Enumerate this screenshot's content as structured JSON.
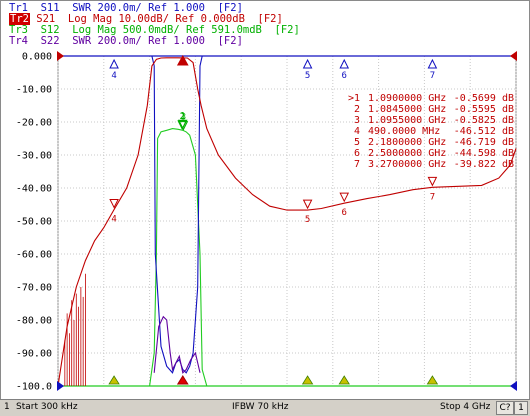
{
  "traces_header": [
    {
      "id": "Tr1",
      "text": "Tr1  S11  SWR 200.0m/ Ref 1.000  [F2]",
      "color": "#1010c0",
      "active": false
    },
    {
      "id": "Tr2",
      "tag": "Tr2",
      "text": " S21  Log Mag 10.00dB/ Ref 0.000dB  [F2]",
      "color": "#c00000",
      "active": true
    },
    {
      "id": "Tr3",
      "text": "Tr3  S12  Log Mag 500.0mdB/ Ref 591.0mdB  [F2]",
      "color": "#00b000",
      "active": false
    },
    {
      "id": "Tr4",
      "text": "Tr4  S22  SWR 200.0m/ Ref 1.000  [F2]",
      "color": "#6000a0",
      "active": false
    }
  ],
  "marker_table": [
    {
      "label": ">1",
      "freq": "1.0900000 GHz",
      "value": "-0.5699 dB"
    },
    {
      "label": "2",
      "freq": "1.0845000 GHz",
      "value": "-0.5595 dB"
    },
    {
      "label": "3",
      "freq": "1.0955000 GHz",
      "value": "-0.5825 dB"
    },
    {
      "label": "4",
      "freq": "490.0000 MHz",
      "value": "-46.512 dB"
    },
    {
      "label": "5",
      "freq": "2.1800000 GHz",
      "value": "-46.719 dB"
    },
    {
      "label": "6",
      "freq": "2.5000000 GHz",
      "value": "-44.598 dB"
    },
    {
      "label": "7",
      "freq": "3.2700000 GHz",
      "value": "-39.822 dB"
    }
  ],
  "statusbar": {
    "channel": "1",
    "start": "Start 300 kHz",
    "ifbw": "IFBW 70 kHz",
    "stop": "Stop 4 GHz",
    "ch_tag": "C?",
    "box": "1"
  },
  "colors": {
    "s11": "#1010c0",
    "s21": "#c00000",
    "s12": "#22cc22",
    "s22": "#6000a0",
    "grid": "#c8c8c8"
  },
  "chart_data": {
    "type": "line",
    "xlabel": "",
    "ylabel": "",
    "xlim": [
      0.0003,
      4.0
    ],
    "ylim": [
      -100,
      0
    ],
    "y_ticks": [
      0,
      -10,
      -20,
      -30,
      -40,
      -50,
      -60,
      -70,
      -80,
      -90,
      -100
    ],
    "y_tick_labels": [
      "0.000",
      "-10.00",
      "-20.00",
      "-30.00",
      "-40.00",
      "-50.00",
      "-60.00",
      "-70.00",
      "-80.00",
      "-90.00",
      "-100.0"
    ],
    "grid": true,
    "series": [
      {
        "name": "S21",
        "color": "#c00000",
        "x": [
          0.0003,
          0.08,
          0.16,
          0.24,
          0.32,
          0.4,
          0.49,
          0.6,
          0.7,
          0.78,
          0.82,
          0.86,
          0.9,
          0.95,
          1.0,
          1.05,
          1.09,
          1.13,
          1.18,
          1.22,
          1.25,
          1.3,
          1.4,
          1.55,
          1.7,
          1.85,
          2.0,
          2.18,
          2.3,
          2.5,
          2.7,
          2.9,
          3.1,
          3.27,
          3.5,
          3.7,
          3.85,
          3.95,
          4.0
        ],
        "y": [
          -100,
          -82,
          -70,
          -62,
          -56,
          -52,
          -46.5,
          -40,
          -30,
          -15,
          -3,
          -1,
          -0.6,
          -0.55,
          -0.56,
          -0.55,
          -0.57,
          -0.6,
          -2,
          -10,
          -15,
          -22,
          -30,
          -37,
          -42,
          -45.5,
          -46.7,
          -46.7,
          -46.2,
          -44.6,
          -43.2,
          -42,
          -40.5,
          -39.8,
          -39.5,
          -39.2,
          -37,
          -33,
          -28
        ]
      },
      {
        "name": "S12",
        "color": "#22cc22",
        "x": [
          0.8,
          0.84,
          0.86,
          0.87,
          0.9,
          0.95,
          1.0,
          1.05,
          1.09,
          1.12,
          1.15,
          1.2,
          1.24,
          1.26,
          1.3
        ],
        "y": [
          -100,
          -90,
          -60,
          -25,
          -23,
          -22.5,
          -22,
          -22.2,
          -22.5,
          -23,
          -24,
          -30,
          -60,
          -95,
          -100
        ]
      },
      {
        "name": "S11",
        "color": "#1010c0",
        "x": [
          0.82,
          0.84,
          0.85,
          0.9,
          0.95,
          1.0,
          1.03,
          1.06,
          1.09,
          1.12,
          1.15,
          1.18,
          1.22,
          1.24,
          1.26
        ],
        "y": [
          0,
          -3,
          -60,
          -88,
          -94,
          -96,
          -93,
          -92,
          -95,
          -96,
          -94,
          -90,
          -70,
          -3,
          0
        ]
      },
      {
        "name": "S22",
        "color": "#6000a0",
        "x": [
          0.84,
          0.88,
          0.92,
          0.95,
          0.98,
          1.0,
          1.03,
          1.06,
          1.09,
          1.12,
          1.16,
          1.2,
          1.24
        ],
        "y": [
          -96,
          -82,
          -79,
          -80,
          -90,
          -95,
          -93,
          -91,
          -96,
          -95,
          -92,
          -90,
          -96
        ]
      }
    ],
    "markers": [
      {
        "label": "4",
        "x": 0.49,
        "y": -46.5
      },
      {
        "label": "5",
        "x": 2.18,
        "y": -46.7
      },
      {
        "label": "6",
        "x": 2.5,
        "y": -44.6
      },
      {
        "label": "7",
        "x": 3.27,
        "y": -39.8
      },
      {
        "label": "1",
        "x": 1.09,
        "y": -22.5
      },
      {
        "label": "2",
        "x": 1.0845,
        "y": -22.7
      },
      {
        "label": "3",
        "x": 1.0955,
        "y": -22.9
      }
    ]
  }
}
